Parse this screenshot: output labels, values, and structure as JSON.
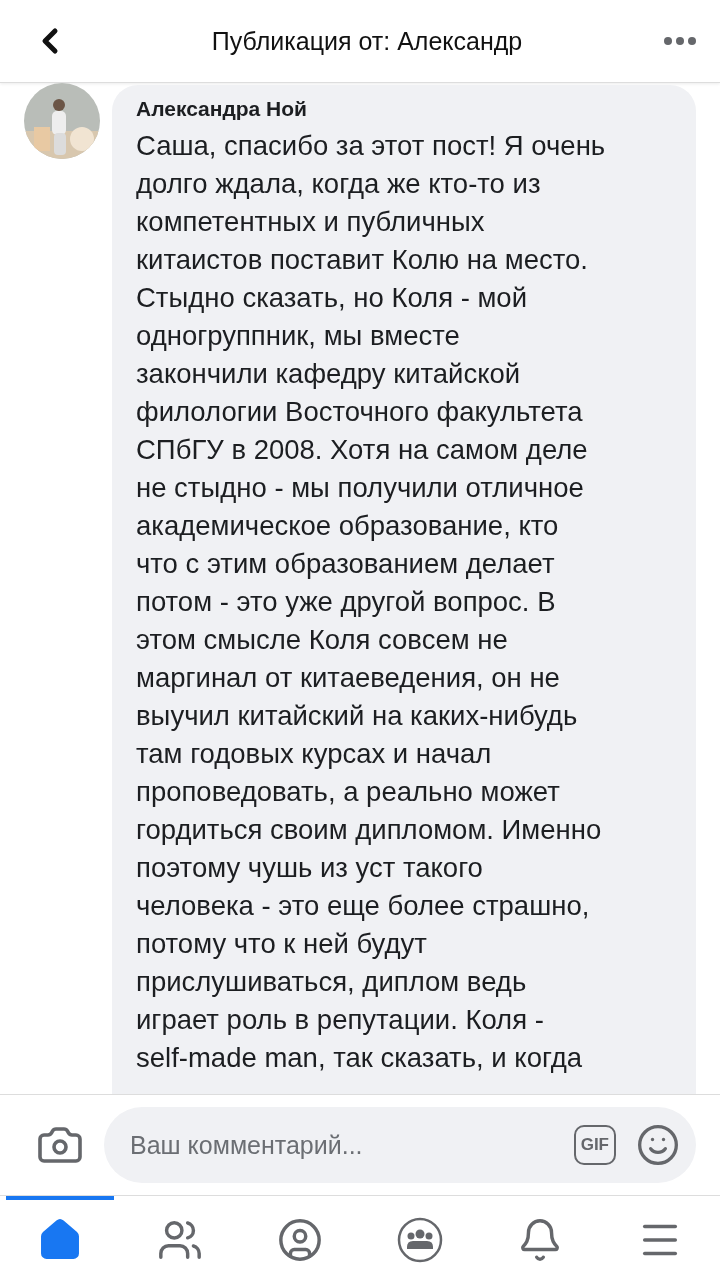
{
  "header": {
    "title": "Публикация от: Александр"
  },
  "comment": {
    "author": "Александра Ной",
    "lines": [
      "Саша, спасибо за этот пост! Я очень",
      "долго ждала, когда же кто-то из",
      "компетентных и публичных",
      "китаистов поставит Колю на место.",
      "Стыдно сказать, но Коля - мой",
      "одногруппник, мы вместе",
      "закончили кафедру китайской",
      "филологии Восточного факультета",
      "СПбГУ в 2008. Хотя на самом деле",
      "не стыдно - мы получили отличное",
      "академическое образование, кто",
      "что с этим образованием делает",
      "потом - это уже другой вопрос. В",
      "этом смысле Коля совсем не",
      "маргинал от китаеведения, он не",
      "выучил китайский на каких-нибудь",
      "там годовых курсах и начал",
      "проповедовать, а реально может",
      "гордиться своим дипломом. Именно",
      "поэтому чушь из уст такого",
      "человека - это еще более страшно,",
      "потому что к ней будут",
      "прислушиваться, диплом ведь",
      "играет роль в репутации. Коля -",
      "self-made man, так сказать, и когда"
    ]
  },
  "composer": {
    "placeholder": "Ваш комментарий...",
    "gif_label": "GIF"
  },
  "tabs": [
    {
      "selected": true
    },
    {
      "selected": false
    },
    {
      "selected": false
    },
    {
      "selected": false
    },
    {
      "selected": false
    },
    {
      "selected": false
    }
  ]
}
